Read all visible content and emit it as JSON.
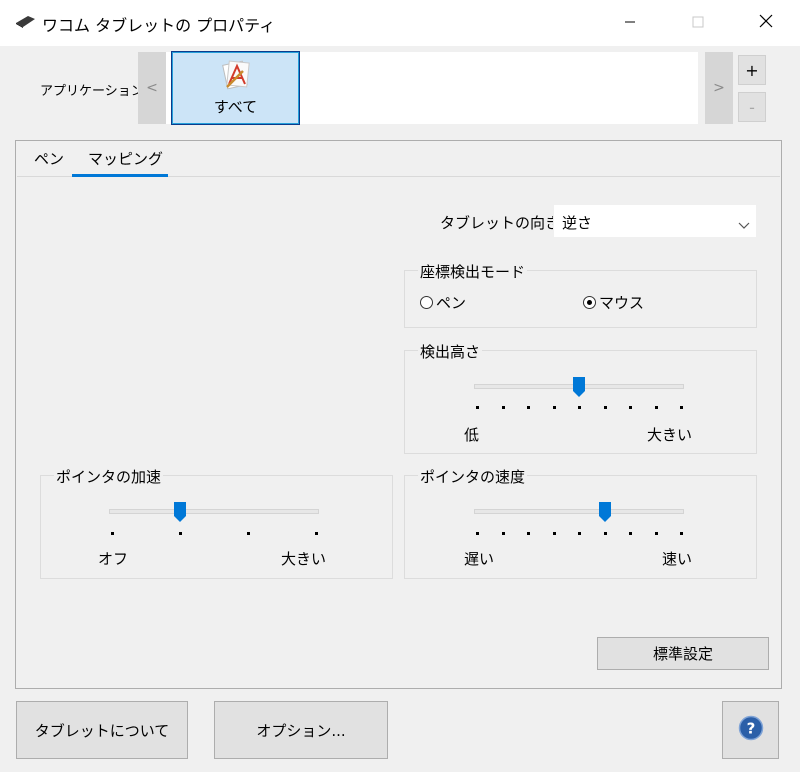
{
  "window": {
    "title": "ワコム タブレットの プロパティ",
    "icon": "tablet-icon"
  },
  "applications": {
    "label": "アプリケーション:",
    "prev": "<",
    "next": ">",
    "add": "+",
    "remove": "-",
    "items": [
      {
        "label": "すべて",
        "icon": "all-apps-icon",
        "selected": true
      }
    ]
  },
  "tabs": [
    {
      "label": "ペン",
      "selected": false
    },
    {
      "label": "マッピング",
      "selected": true
    }
  ],
  "mapping": {
    "orientation_label": "タブレットの向き:",
    "orientation_value": "逆さ",
    "mode": {
      "title": "座標検出モード",
      "options": [
        {
          "label": "ペン",
          "selected": false
        },
        {
          "label": "マウス",
          "selected": true
        }
      ]
    },
    "height": {
      "title": "検出高さ",
      "min_label": "低",
      "max_label": "大きい",
      "ticks": 9,
      "value_fraction": 0.5
    },
    "acceleration": {
      "title": "ポインタの加速",
      "min_label": "オフ",
      "max_label": "大きい",
      "ticks": 4,
      "value_fraction": 0.3333
    },
    "speed": {
      "title": "ポインタの速度",
      "min_label": "遅い",
      "max_label": "速い",
      "ticks": 9,
      "value_fraction": 0.625
    },
    "defaults_button": "標準設定"
  },
  "footer": {
    "about_button": "タブレットについて",
    "options_button": "オプション...",
    "help_icon": "help-icon"
  },
  "colors": {
    "accent": "#0078d7",
    "selected_tile": "#cce4f7",
    "help_blue": "#2b5fa8"
  }
}
